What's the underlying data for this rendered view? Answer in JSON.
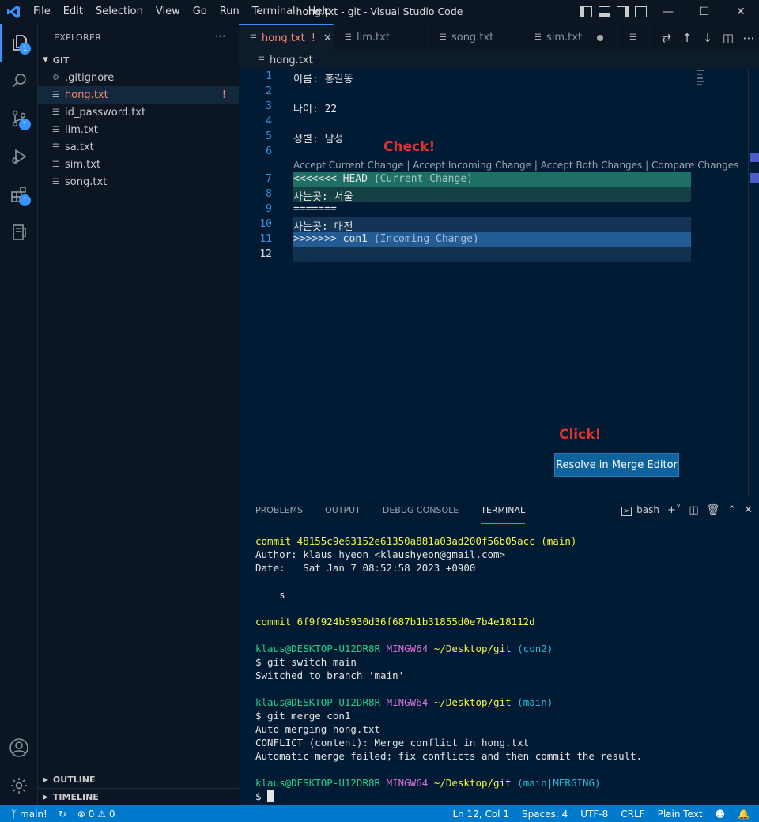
{
  "window": {
    "title": "hong.txt - git - Visual Studio Code"
  },
  "menu": [
    "File",
    "Edit",
    "Selection",
    "View",
    "Go",
    "Run",
    "Terminal",
    "Help"
  ],
  "activity": {
    "explorer_badge": "1",
    "scm_badge": "1",
    "extensions_badge": "1"
  },
  "explorer": {
    "title": "EXPLORER",
    "folder": "GIT",
    "files": [
      {
        "name": ".gitignore",
        "icon": "gear-icon"
      },
      {
        "name": "hong.txt",
        "icon": "file-icon",
        "conflict": "!"
      },
      {
        "name": "id_password.txt",
        "icon": "file-icon"
      },
      {
        "name": "lim.txt",
        "icon": "file-icon"
      },
      {
        "name": "sa.txt",
        "icon": "file-icon"
      },
      {
        "name": "sim.txt",
        "icon": "file-icon"
      },
      {
        "name": "song.txt",
        "icon": "file-icon"
      }
    ],
    "outline": "OUTLINE",
    "timeline": "TIMELINE"
  },
  "tabs": [
    {
      "label": "hong.txt",
      "state": "!"
    },
    {
      "label": "lim.txt"
    },
    {
      "label": "song.txt"
    },
    {
      "label": "sim.txt"
    }
  ],
  "breadcrumb": "hong.txt",
  "editor": {
    "lines": [
      {
        "n": "1",
        "text": "이름: 홍길동"
      },
      {
        "n": "2",
        "text": ""
      },
      {
        "n": "3",
        "text": "나이: 22"
      },
      {
        "n": "4",
        "text": ""
      },
      {
        "n": "5",
        "text": "성별: 남성"
      },
      {
        "n": "6",
        "text": ""
      },
      {
        "n": "7",
        "text": "<<<<<<< HEAD",
        "note": "(Current Change)"
      },
      {
        "n": "8",
        "text": "사는곳: 서울"
      },
      {
        "n": "9",
        "text": "======="
      },
      {
        "n": "10",
        "text": "사는곳: 대전"
      },
      {
        "n": "11",
        "text": ">>>>>>> con1",
        "note": "(Incoming Change)"
      },
      {
        "n": "12",
        "text": ""
      }
    ],
    "codelens": {
      "accept_current": "Accept Current Change",
      "accept_incoming": "Accept Incoming Change",
      "accept_both": "Accept Both Changes",
      "compare": "Compare Changes",
      "sep": " | "
    },
    "annotation_check": "Check!",
    "annotation_click": "Click!",
    "resolve_button": "Resolve in Merge Editor"
  },
  "panel": {
    "tabs": [
      "PROBLEMS",
      "OUTPUT",
      "DEBUG CONSOLE",
      "TERMINAL"
    ],
    "shell": "bash"
  },
  "terminal": {
    "commit1": "commit 48155c9e63152e61350a881a03ad200f56b05acc",
    "commit1_ref": "(main)",
    "author": "Author: klaus hyeon <klaushyeon@gmail.com>",
    "date": "Date:   Sat Jan 7 08:52:58 2023 +0900",
    "message": "    s",
    "commit2": "commit 6f9f924b5930d36f687b1b31855d0e7b4e18112d",
    "user": "klaus@DESKTOP-U12DR8R",
    "mingw": "MINGW64",
    "path": "~/Desktop/git",
    "branch1": "(con2)",
    "cmd1": "$ git switch main",
    "out1": "Switched to branch 'main'",
    "branch2": "(main)",
    "cmd2": "$ git merge con1",
    "out2": "Auto-merging hong.txt",
    "out3": "CONFLICT (content): Merge conflict in hong.txt",
    "out4": "Automatic merge failed; fix conflicts and then commit the result.",
    "branch3": "(main|MERGING)",
    "prompt": "$"
  },
  "status": {
    "branch": "main!",
    "errors": "0",
    "warnings": "0",
    "position": "Ln 12, Col 1",
    "spaces": "Spaces: 4",
    "encoding": "UTF-8",
    "eol": "CRLF",
    "language": "Plain Text"
  },
  "colors": {
    "accent": "#007acc",
    "current_header": "#1f6f64",
    "current_body": "#143f45",
    "incoming_header": "#235b94",
    "incoming_body": "#143456",
    "annotation": "#e03030"
  }
}
